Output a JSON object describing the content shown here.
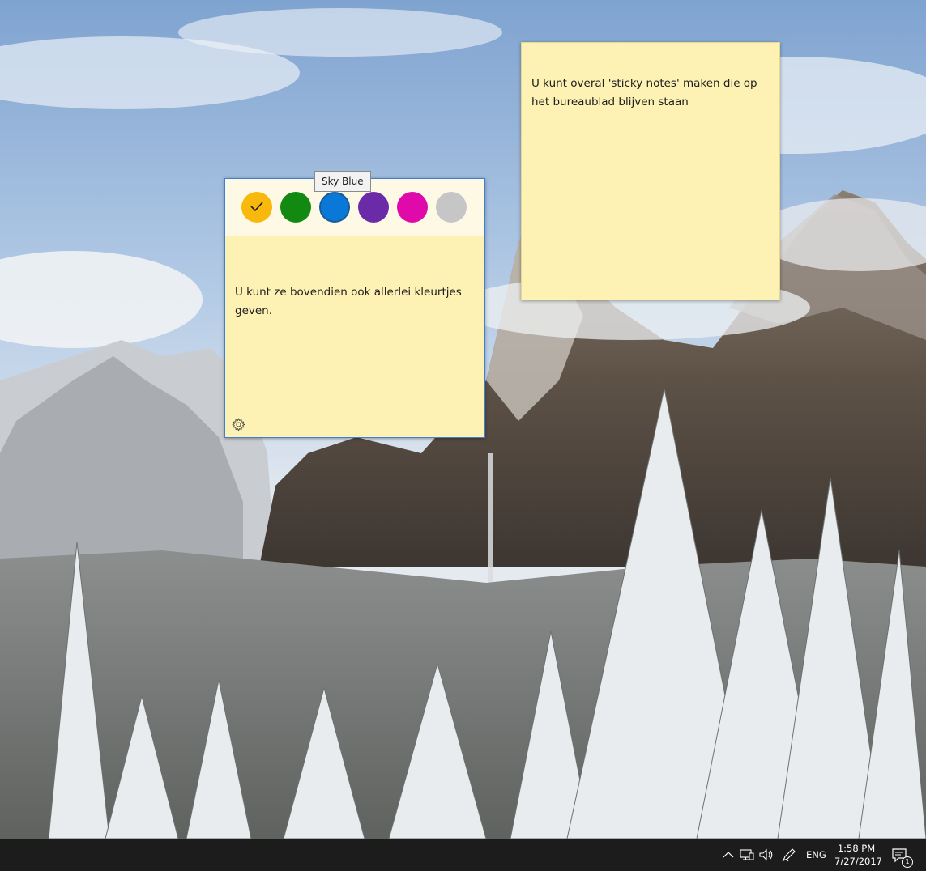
{
  "notes": {
    "right_note": {
      "text": "U kunt overal 'sticky notes' maken die op het bureaublad blijven staan"
    },
    "left_note": {
      "text": "U kunt ze bovendien ook allerlei kleurtjes geven.",
      "settings_icon": "gear-icon"
    }
  },
  "color_picker": {
    "colors": [
      {
        "name": "yellow",
        "hex": "#f8b90c",
        "selected": true
      },
      {
        "name": "green",
        "hex": "#128a12"
      },
      {
        "name": "sky-blue",
        "hex": "#0a78d7",
        "hovered": true
      },
      {
        "name": "purple",
        "hex": "#6b2aa8"
      },
      {
        "name": "pink",
        "hex": "#e00aab"
      },
      {
        "name": "grey",
        "hex": "#c6c6c6"
      }
    ],
    "tooltip": "Sky Blue",
    "check_icon": "checkmark-icon"
  },
  "taskbar": {
    "tray_icons": [
      "chevron-up-icon",
      "network-icon",
      "volume-icon",
      "pen-icon"
    ],
    "language": "ENG",
    "time": "1:58 PM",
    "date": "7/27/2017",
    "notifications_count": "1",
    "notification_icon": "action-center-icon"
  },
  "colors": {
    "note_background": "#fdf1b3",
    "color_bar_background": "#fef9e4",
    "taskbar_background": "#1c1c1c"
  }
}
